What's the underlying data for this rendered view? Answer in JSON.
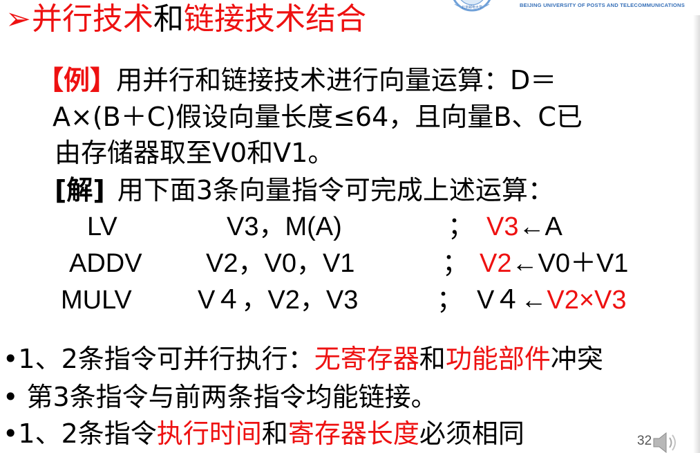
{
  "title": {
    "arrow": "➢",
    "part1": "并行技术",
    "part2": "和",
    "part3": "链接技术结合"
  },
  "logo": {
    "emblem_text": "北京邮电大学",
    "english_name": "BEIJING UNIVERSITY OF POSTS AND TELECOMMUNICATIONS"
  },
  "example": {
    "bracket_label": "【例】",
    "line1_text": "用并行和链接技术进行向量运算：D＝",
    "line2_text": "A×(B＋C)假设向量长度≤64，且向量B、C已",
    "line3_text": "由存储器取至V0和V1。"
  },
  "solution": {
    "label": "[解]",
    "text": "用下面3条向量指令可完成上述运算："
  },
  "instructions": [
    {
      "op": "LV",
      "operands_pre": "V3，M(A)",
      "digit": "",
      "operands_post": "",
      "sep": "；",
      "comment_red": "V3",
      "comment_black": "←A",
      "comment_digit": "",
      "comment_mid": "",
      "comment_tail_red": ""
    },
    {
      "op": "ADDV",
      "operands_pre": "V2，V0，V1",
      "digit": "",
      "operands_post": "",
      "sep": "；",
      "comment_red": "V2",
      "comment_black": "←V0＋V1",
      "comment_digit": "",
      "comment_mid": "",
      "comment_tail_red": ""
    },
    {
      "op": "MULV",
      "operands_pre": "V",
      "digit": "４",
      "operands_post": "，V2，V3",
      "sep": "；",
      "comment_red": "",
      "comment_black": "V",
      "comment_digit": "４",
      "comment_mid": "←",
      "comment_tail_red": "V2×V3"
    }
  ],
  "bullets": [
    {
      "marker": "•",
      "text_a": "1、2条指令可并行执行：",
      "red_a": "无寄存器",
      "text_b": "和",
      "red_b": "功能部件",
      "text_c": "冲突"
    },
    {
      "marker": "• ",
      "text_a": "第3条指令与前两条指令均能链接。",
      "red_a": "",
      "text_b": "",
      "red_b": "",
      "text_c": ""
    },
    {
      "marker": "•",
      "text_a": "1、2条指令",
      "red_a": "执行时间",
      "text_b": "和",
      "red_b": "寄存器长度",
      "text_c": "必须相同"
    }
  ],
  "page_number": "32",
  "icons": {
    "title_arrow": "arrow-bullet-icon",
    "speaker": "speaker-icon"
  },
  "colors": {
    "accent_red": "#ee1111",
    "text": "#000000",
    "logo_blue": "#3770b8"
  }
}
